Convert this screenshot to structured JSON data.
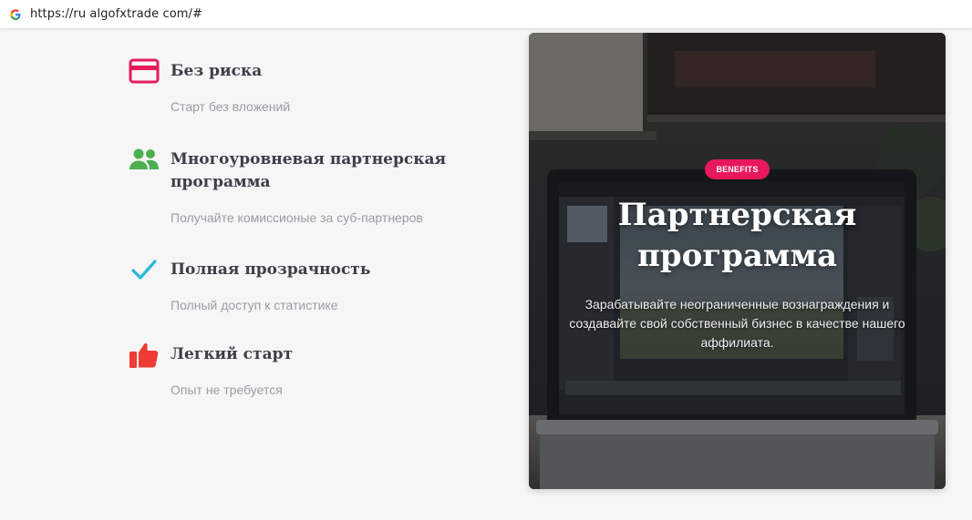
{
  "browser": {
    "url": "https://ru algofxtrade com/#",
    "favicon": "google-g-icon"
  },
  "features": [
    {
      "icon": "credit-card-icon",
      "icon_color": "#e8195b",
      "title": "Без риска",
      "description": "Старт без вложений"
    },
    {
      "icon": "users-icon",
      "icon_color": "#4caf50",
      "title": "Многоуровневая партнерская программа",
      "description": "Получайте комиссионые за суб-партнеров"
    },
    {
      "icon": "checkmark-icon",
      "icon_color": "#29b6d8",
      "title": "Полная прозрачность",
      "description": "Полный доступ к статистике"
    },
    {
      "icon": "thumbs-up-icon",
      "icon_color": "#ee3b34",
      "title": "Легкий старт",
      "description": "Опыт не требуется"
    }
  ],
  "hero": {
    "badge": "BENEFITS",
    "badge_color": "#e8195b",
    "title": "Партнерская программа",
    "text": "Зарабатывайте неограниченные вознаграждения и создавайте свой собственный бизнес в качестве нашего аффилиата."
  }
}
